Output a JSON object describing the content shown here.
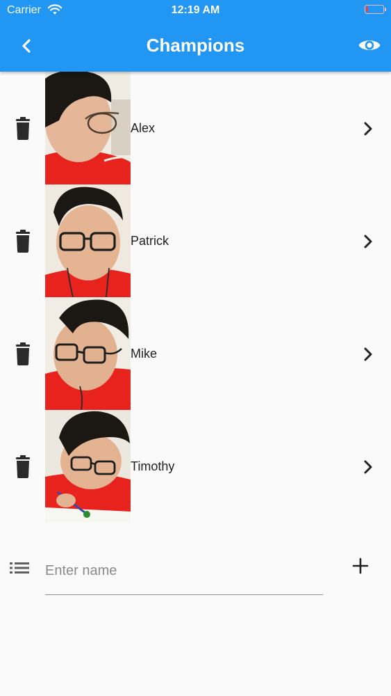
{
  "status_bar": {
    "carrier": "Carrier",
    "time": "12:19 AM"
  },
  "app_bar": {
    "title": "Champions"
  },
  "champions": [
    {
      "name": "Alex"
    },
    {
      "name": "Patrick"
    },
    {
      "name": "Mike"
    },
    {
      "name": "Timothy"
    }
  ],
  "input": {
    "placeholder": "Enter name",
    "value": ""
  },
  "colors": {
    "primary": "#2196f3",
    "background": "#fafafa",
    "shirt": "#e8231e"
  },
  "icons": {
    "back": "chevron-left-icon",
    "visibility": "eye-icon",
    "delete": "trash-icon",
    "open": "chevron-right-icon",
    "list": "list-icon",
    "add": "plus-icon"
  }
}
